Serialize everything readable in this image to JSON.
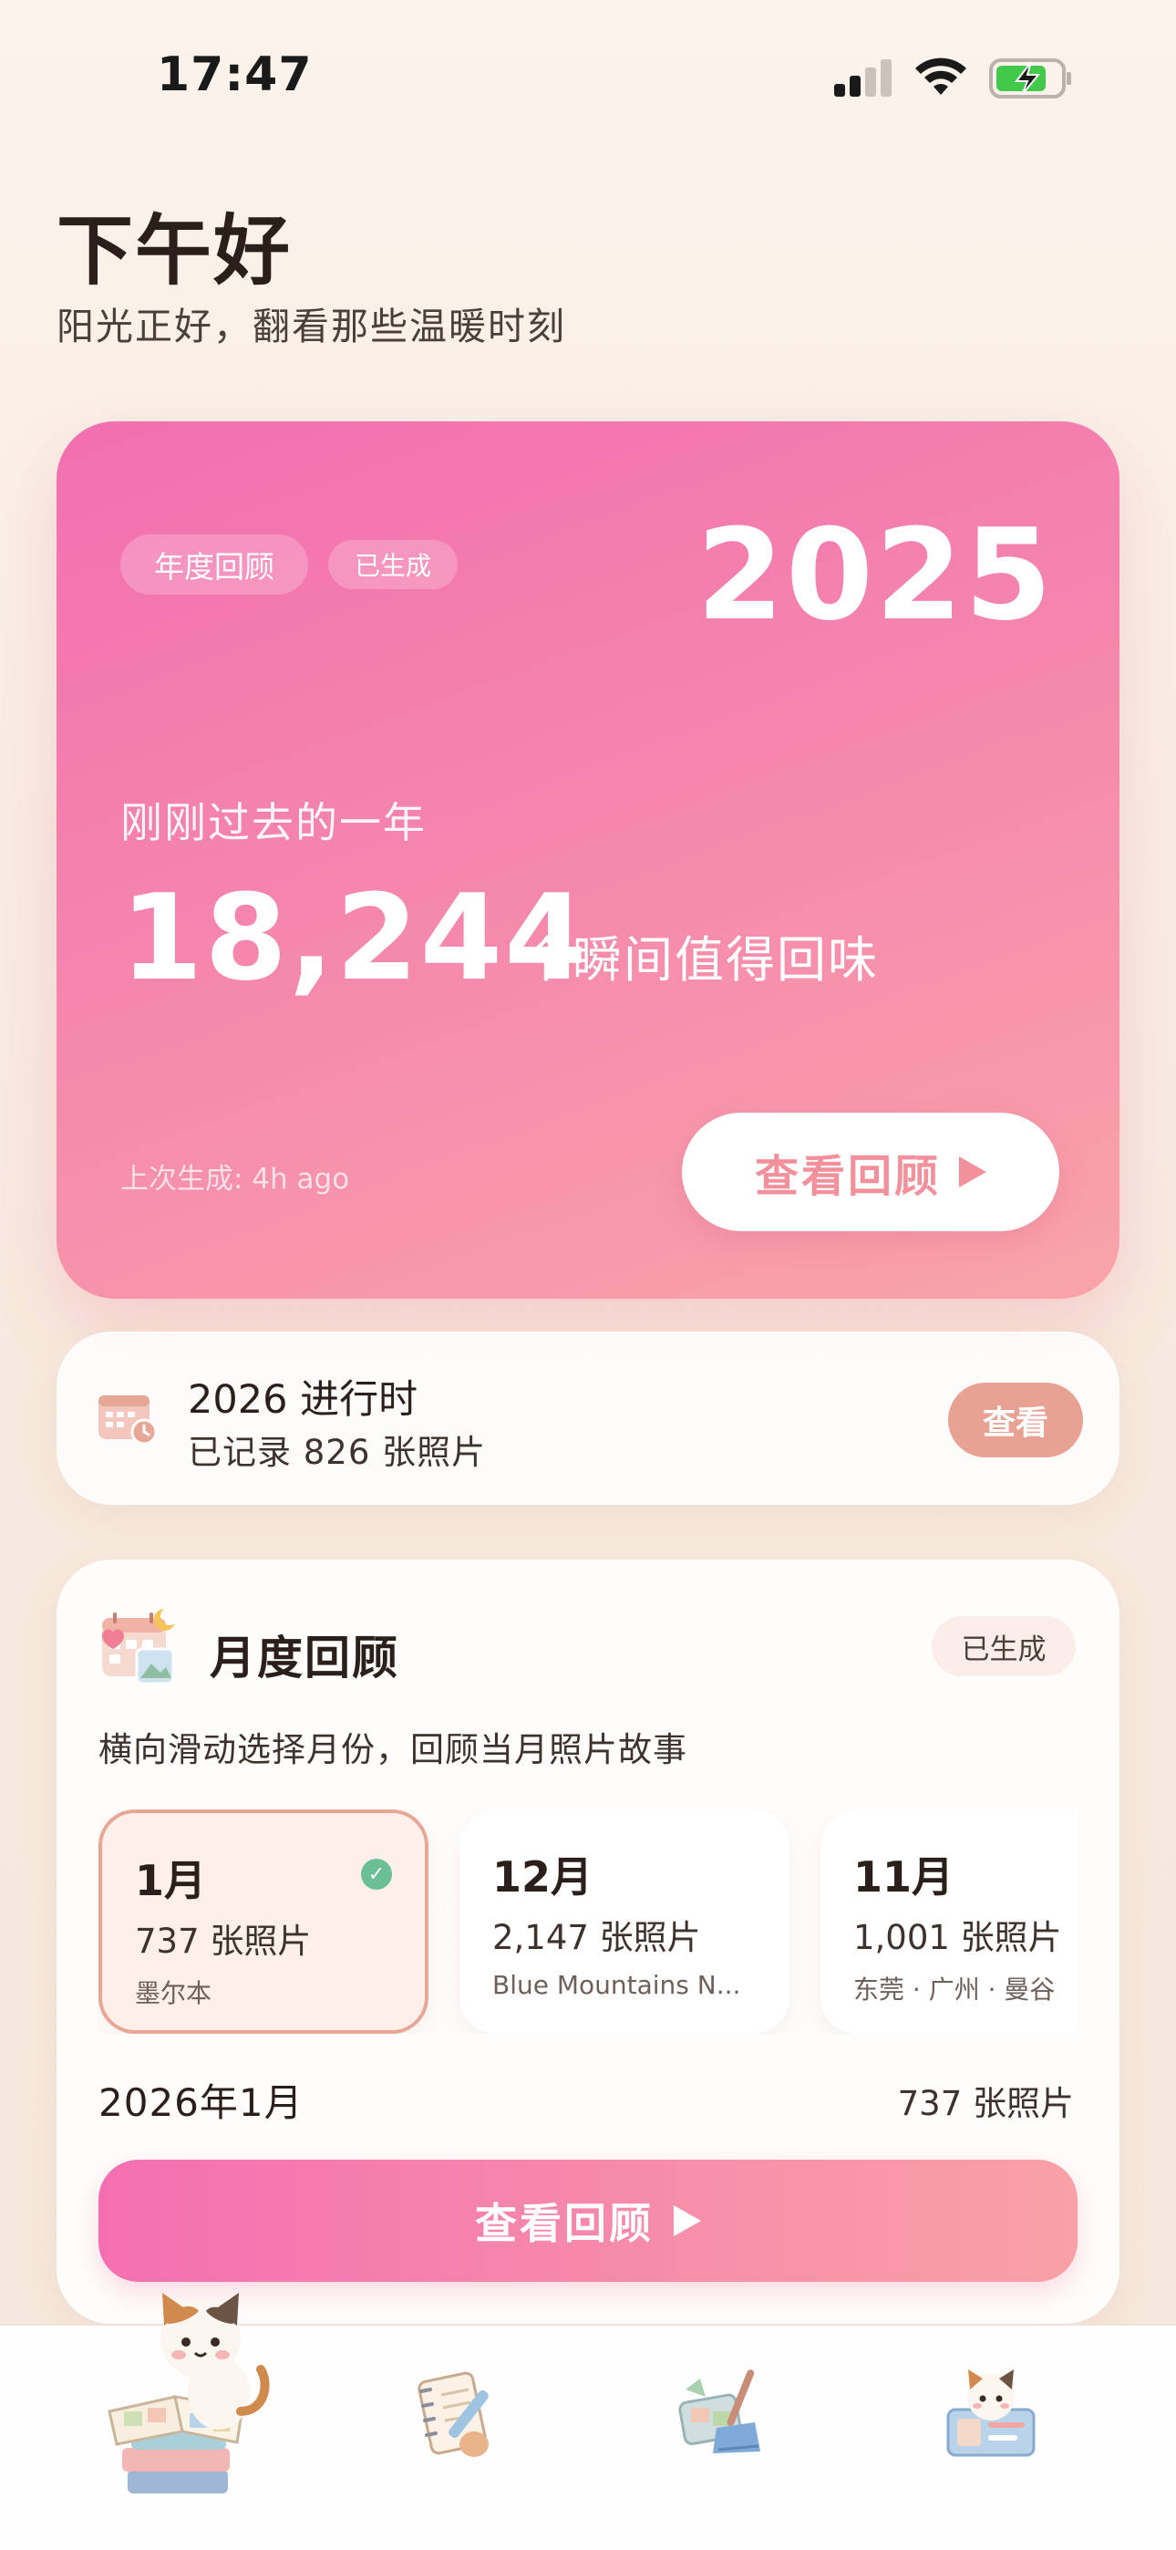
{
  "status_bar": {
    "time": "17:47",
    "icons": [
      "cellular-signal-icon",
      "wifi-icon",
      "battery-charging-icon"
    ]
  },
  "greeting": {
    "title": "下午好",
    "subtitle": "阳光正好，翻看那些温暖时刻"
  },
  "annual_card": {
    "pill_annual": "年度回顾",
    "pill_generated": "已生成",
    "year": "2025",
    "past_label": "刚刚过去的一年",
    "moment_count": "18,244",
    "moment_suffix": "个瞬间值得回味",
    "last_generated": "上次生成: 4h ago",
    "view_button": "查看回顾",
    "colors": {
      "gradient_start": "#f26fb0",
      "gradient_end": "#f9a4a9",
      "button_text": "#f2919b"
    }
  },
  "progress_card": {
    "title": "2026 进行时",
    "subtitle": "已记录 826 张照片",
    "view_button": "查看",
    "icon": "calendar-clock-icon"
  },
  "monthly_card": {
    "title": "月度回顾",
    "badge": "已生成",
    "hint": "横向滑动选择月份，回顾当月照片故事",
    "icon": "calendar-photos-icon",
    "months": [
      {
        "month": "1月",
        "count": "737 张照片",
        "place": "墨尔本",
        "selected": true
      },
      {
        "month": "12月",
        "count": "2,147 张照片",
        "place": "Blue Mountains N...",
        "selected": false
      },
      {
        "month": "11月",
        "count": "1,001 张照片",
        "place": "东莞 · 广州 · 曼谷",
        "selected": false
      }
    ],
    "selected_month_label": "2026年1月",
    "selected_month_count": "737 张照片",
    "view_button": "查看回顾"
  },
  "tab_bar": {
    "tabs": [
      {
        "icon": "cat-with-photo-books-icon",
        "active": true
      },
      {
        "icon": "notebook-pen-icon",
        "active": false
      },
      {
        "icon": "cleanup-broom-icon",
        "active": false
      },
      {
        "icon": "cat-profile-card-icon",
        "active": false
      }
    ]
  }
}
